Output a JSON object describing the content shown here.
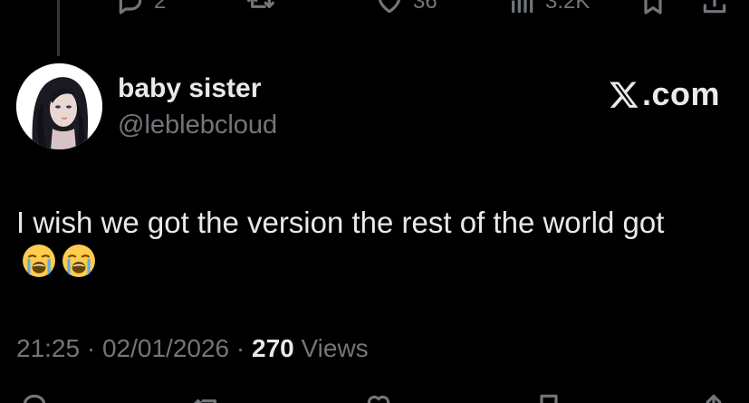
{
  "top_actions": {
    "reply_count": "2",
    "like_count": "36",
    "views_count": "3.2K"
  },
  "post": {
    "display_name": "baby sister",
    "handle": "@leblebcloud",
    "brand_text": ".com",
    "text": "I wish we got the version the rest of the world got",
    "emojis": [
      "loudly-crying-face-icon",
      "loudly-crying-face-icon"
    ],
    "time": "21:25",
    "date": "02/01/2026",
    "views_count": "270",
    "views_label": "Views"
  },
  "colors": {
    "background": "#000000",
    "text_primary": "#e7e9ea",
    "text_secondary": "#71767b",
    "thread_line": "#333639"
  }
}
